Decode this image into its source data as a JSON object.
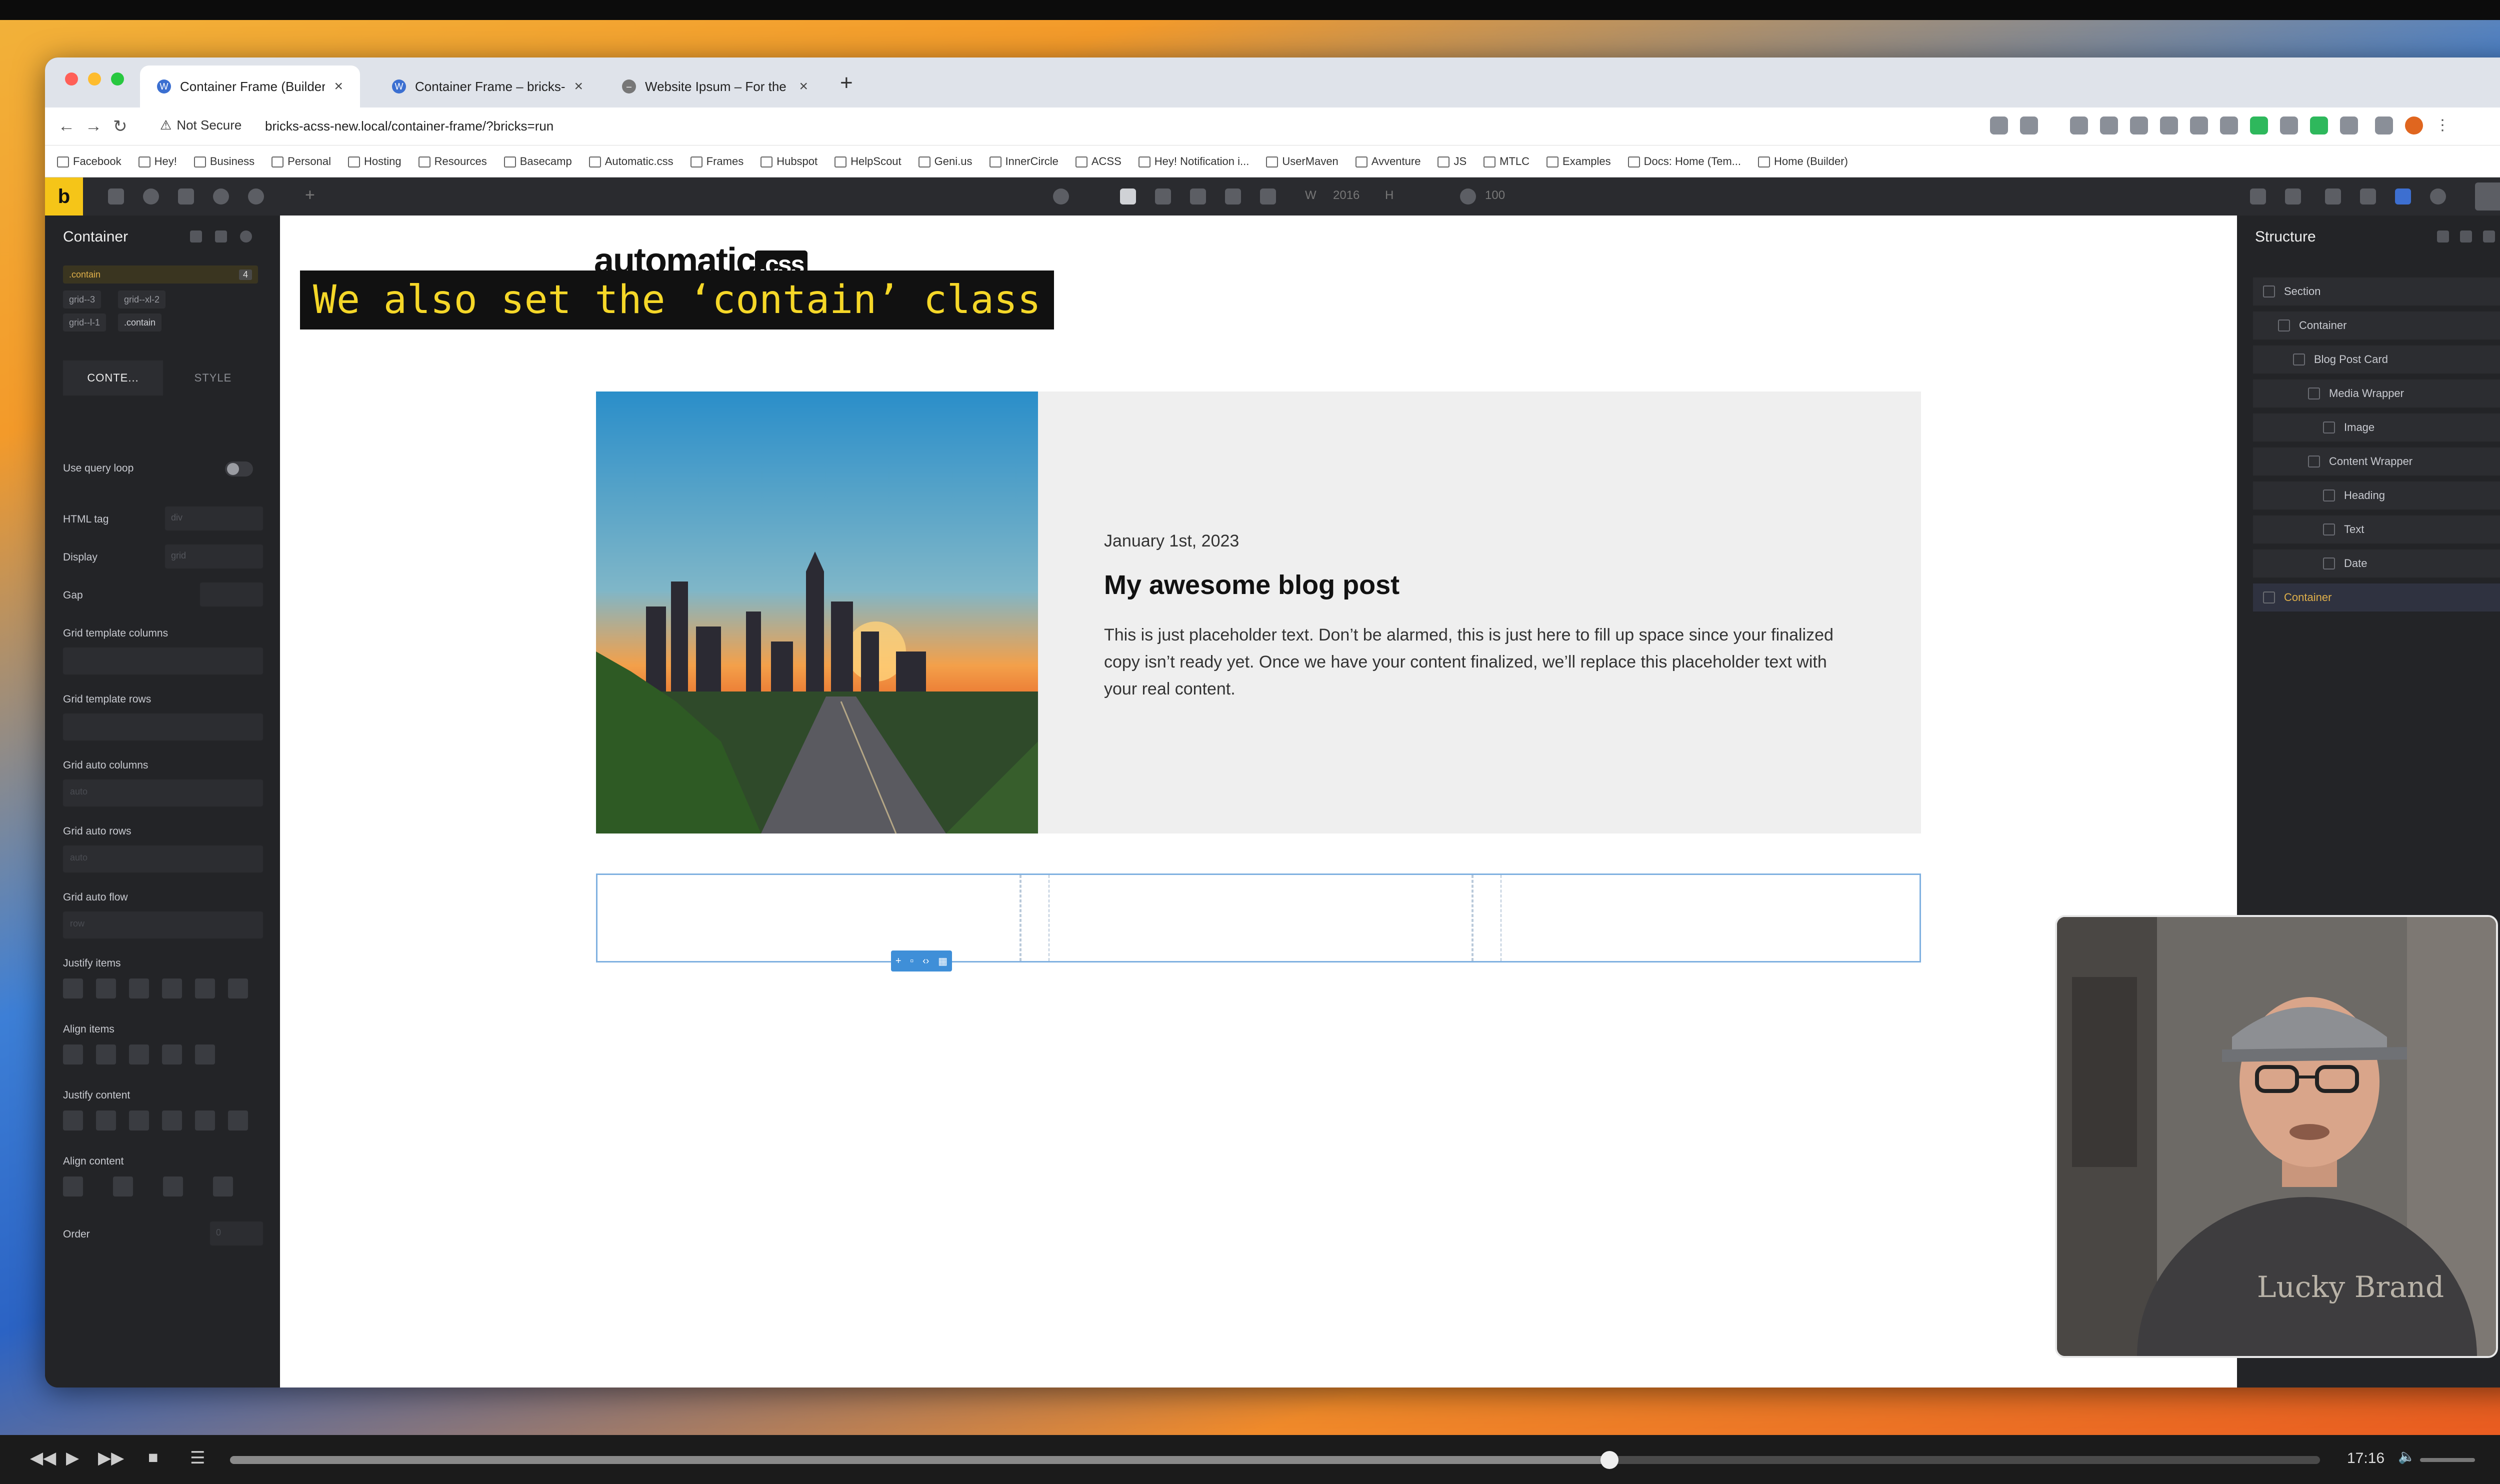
{
  "browser": {
    "tabs": [
      {
        "title": "Container Frame (Builder)",
        "active": true
      },
      {
        "title": "Container Frame – bricks-acs",
        "active": false
      },
      {
        "title": "Website Ipsum – For the typo",
        "active": false
      }
    ],
    "new_tab_label": "+",
    "not_secure_label": "Not Secure",
    "url": "bricks-acss-new.local/container-frame/?bricks=run",
    "bookmarks": [
      "Facebook",
      "Hey!",
      "Business",
      "Personal",
      "Hosting",
      "Resources",
      "Basecamp",
      "Automatic.css",
      "Frames",
      "Hubspot",
      "HelpScout",
      "Geni.us",
      "InnerCircle",
      "ACSS",
      "Hey! Notification i...",
      "UserMaven",
      "Avventure",
      "JS",
      "MTLC",
      "Examples",
      "Docs: Home (Tem...",
      "Home (Builder)"
    ]
  },
  "toolbar": {
    "logo": "b",
    "width_label": "W",
    "width_value": "2016",
    "height_label": "H",
    "zoom_value": "100"
  },
  "left_panel": {
    "title": "Container",
    "classes": [
      ".contain",
      "grid--3",
      "grid--xl-2",
      "grid--l-1",
      ".contain"
    ],
    "class_count": "4",
    "tab_content": "CONTE...",
    "tab_style": "STYLE",
    "fields": {
      "use_query_loop": "Use query loop",
      "html_tag": "HTML tag",
      "html_tag_value": "div",
      "display": "Display",
      "display_value": "grid",
      "gap": "Gap",
      "grid_template_columns": "Grid template columns",
      "grid_template_rows": "Grid template rows",
      "grid_auto_columns": "Grid auto columns",
      "grid_auto_columns_placeholder": "auto",
      "grid_auto_rows": "Grid auto rows",
      "grid_auto_rows_placeholder": "auto",
      "grid_auto_flow": "Grid auto flow",
      "grid_auto_flow_value": "row",
      "justify_items": "Justify items",
      "align_items": "Align items",
      "justify_content": "Justify content",
      "align_content": "Align content",
      "order": "Order",
      "order_value": "0"
    }
  },
  "canvas": {
    "logo_text": "automatic",
    "logo_suffix": ".css",
    "caption": "We also set the ‘contain’ class",
    "card": {
      "date": "January 1st, 2023",
      "title": "My awesome blog post",
      "text": "This is just placeholder text. Don’t be alarmed, this is just here to fill up space since your finalized copy isn’t ready yet. Once we have your content finalized, we’ll replace this placeholder text with your real content."
    }
  },
  "structure": {
    "title": "Structure",
    "nodes": [
      "Section",
      "Container",
      "Blog Post Card",
      "Media Wrapper",
      "Image",
      "Content Wrapper",
      "Heading",
      "Text",
      "Date",
      "Container"
    ]
  },
  "player": {
    "time": "17:16",
    "progress": 0.66
  },
  "colors": {
    "accent": "#f5c518",
    "caption_text": "#f5d728",
    "selection": "#3f8fd8"
  }
}
